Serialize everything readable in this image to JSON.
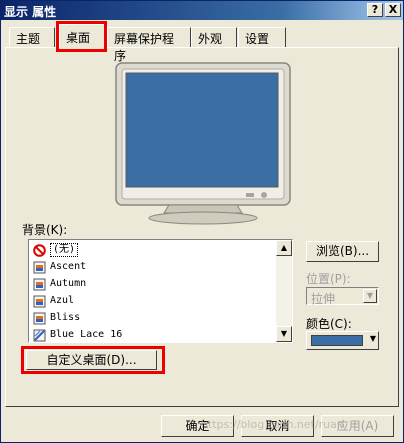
{
  "window": {
    "title": "显示 属性",
    "help_glyph": "?",
    "close_glyph": "X"
  },
  "tabs": [
    {
      "label": "主题",
      "active": false
    },
    {
      "label": "桌面",
      "active": true
    },
    {
      "label": "屏幕保护程序",
      "active": false
    },
    {
      "label": "外观",
      "active": false
    },
    {
      "label": "设置",
      "active": false
    }
  ],
  "background": {
    "label": "背景(K):",
    "items": [
      {
        "label": "(无)",
        "icon": "none-icon",
        "selected": true
      },
      {
        "label": "Ascent",
        "icon": "image-file-icon"
      },
      {
        "label": "Autumn",
        "icon": "image-file-icon"
      },
      {
        "label": "Azul",
        "icon": "image-file-icon"
      },
      {
        "label": "Bliss",
        "icon": "image-file-icon"
      },
      {
        "label": "Blue Lace 16",
        "icon": "bmp-file-icon"
      }
    ]
  },
  "browse_button": "浏览(B)...",
  "position": {
    "label": "位置(P):",
    "value": "拉伸"
  },
  "color": {
    "label": "颜色(C):",
    "value": "#3a6ea5"
  },
  "customize_button": "自定义桌面(D)...",
  "footer": {
    "ok": "确定",
    "cancel": "取消",
    "apply": "应用(A)"
  },
  "watermark": "https://blog.csdn.net/ruan"
}
